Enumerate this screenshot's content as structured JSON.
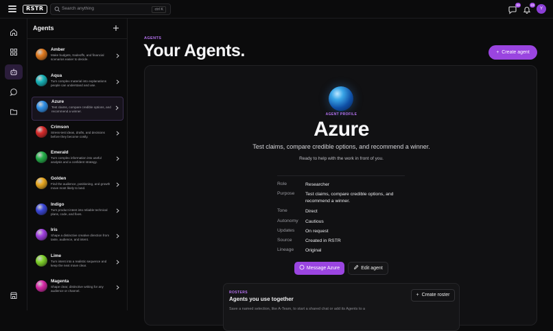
{
  "topbar": {
    "logo": "RSTR",
    "search_placeholder": "Search anything",
    "search_shortcut": "ctrl K",
    "notifications_a": "33",
    "notifications_b": "23",
    "avatar_initial": "Y"
  },
  "panel": {
    "title": "Agents",
    "items": [
      {
        "name": "Amber",
        "desc": "Make budgets, tradeoffs, and financial scenarios easier to decide.",
        "color": "#e07a1f"
      },
      {
        "name": "Aqua",
        "desc": "Turn complex material into explanations people can understand and use.",
        "color": "#17b3b8"
      },
      {
        "name": "Azure",
        "desc": "Test claims, compare credible options, and recommend a winner.",
        "color": "#2f8fe6"
      },
      {
        "name": "Crimson",
        "desc": "Stress-test ideas, drafts, and decisions before they become costly.",
        "color": "#d62a2a"
      },
      {
        "name": "Emerald",
        "desc": "Turn complex information into useful analysis and a confident strategy.",
        "color": "#25b04a"
      },
      {
        "name": "Golden",
        "desc": "Find the audience, positioning, and growth move most likely to land.",
        "color": "#e9a820"
      },
      {
        "name": "Indigo",
        "desc": "Turn product intent into reliable technical plans, code, and fixes.",
        "color": "#3b47d8"
      },
      {
        "name": "Iris",
        "desc": "Shape a distinctive creative direction from taste, audience, and intent.",
        "color": "#a040e0"
      },
      {
        "name": "Lime",
        "desc": "Turn intent into a realistic sequence and keep the next move clear.",
        "color": "#7fd22a"
      },
      {
        "name": "Magenta",
        "desc": "Shape clear, distinctive writing for any audience or channel.",
        "color": "#d82aa8"
      }
    ]
  },
  "main": {
    "eyebrow": "AGENTS",
    "title": "Your Agents.",
    "create_label": "Create agent"
  },
  "profile": {
    "label": "AGENT PROFILE",
    "name": "Azure",
    "tagline": "Test claims, compare credible options, and recommend a winner.",
    "ready": "Ready to help with the work in front of you.",
    "props": [
      {
        "label": "Role",
        "value": "Researcher"
      },
      {
        "label": "Purpose",
        "value": "Test claims, compare credible options, and recommend a winner."
      },
      {
        "label": "Tone",
        "value": "Direct"
      },
      {
        "label": "Autonomy",
        "value": "Cautious"
      },
      {
        "label": "Updates",
        "value": "On request"
      },
      {
        "label": "Source",
        "value": "Created in RSTR"
      },
      {
        "label": "Lineage",
        "value": "Original"
      }
    ],
    "message_label": "Message Azure",
    "edit_label": "Edit agent"
  },
  "roster": {
    "eyebrow": "ROSTERS",
    "title": "Agents you use together",
    "desc": "Save a named selection, like A-Team, to start a shared chat or add its Agents to a",
    "create_label": "Create roster"
  },
  "colors": {
    "accent": "#9a45e0",
    "accent_text": "#b873f3",
    "background": "#0b0b0c"
  }
}
